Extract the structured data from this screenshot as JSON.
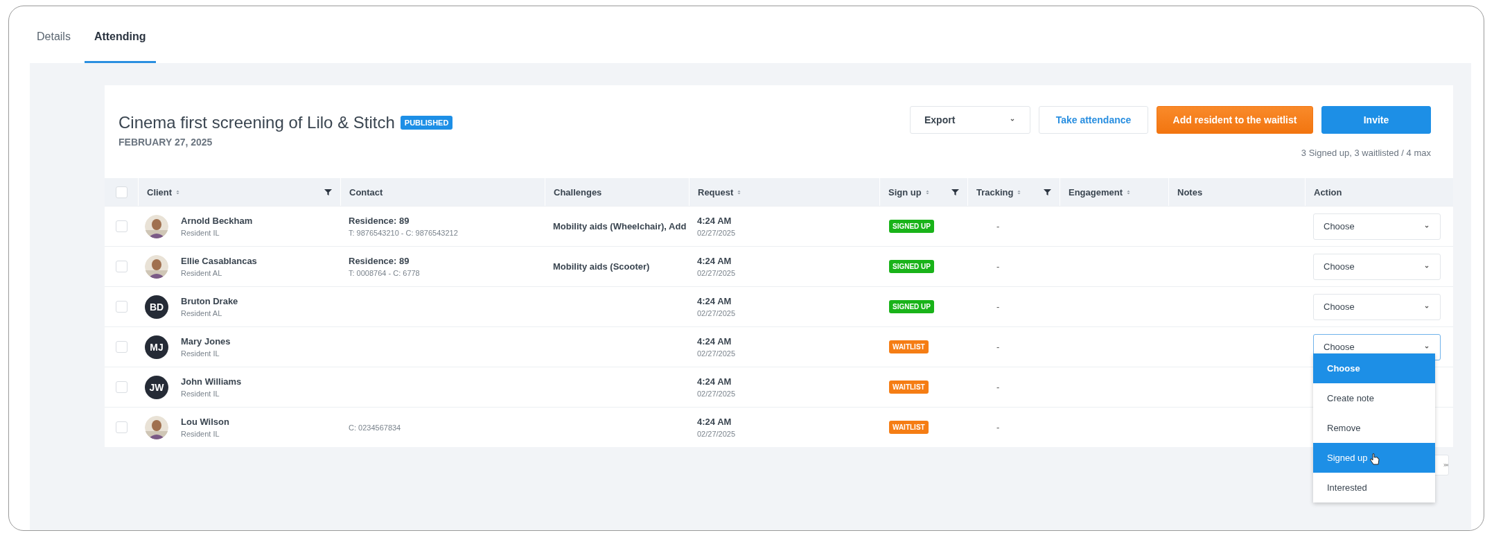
{
  "tabs": [
    {
      "label": "Details",
      "selected": false
    },
    {
      "label": "Attending",
      "selected": true
    }
  ],
  "event": {
    "title": "Cinema first screening of Lilo & Stitch",
    "status": "PUBLISHED",
    "date": "FEBRUARY 27, 2025"
  },
  "toolbar": {
    "export": "Export",
    "take_attendance": "Take attendance",
    "add_waitlist": "Add resident to the waitlist",
    "invite": "Invite",
    "summary": "3 Signed up, 3 waitlisted / 4 max"
  },
  "table": {
    "all_checked": false,
    "columns": [
      {
        "label": "Client",
        "sortable": true,
        "filter": true
      },
      {
        "label": "Contact",
        "sortable": false,
        "filter": false
      },
      {
        "label": "Challenges",
        "sortable": false,
        "filter": false
      },
      {
        "label": "Request",
        "sortable": true,
        "filter": false
      },
      {
        "label": "Sign up",
        "sortable": true,
        "filter": true
      },
      {
        "label": "Tracking",
        "sortable": true,
        "filter": true
      },
      {
        "label": "Engagement",
        "sortable": true,
        "filter": false
      },
      {
        "label": "Notes",
        "sortable": false,
        "filter": false
      },
      {
        "label": "Action",
        "sortable": false,
        "filter": false
      }
    ],
    "rows": [
      {
        "checked": false,
        "name": "Arnold Beckham",
        "level": "Resident IL",
        "contact_title": "Residence: 89",
        "contact_detail": "T: 9876543210 - C: 9876543212",
        "challenges": "Mobility aids (Wheelchair), Add",
        "time": "4:24 AM",
        "date": "02/27/2025",
        "signup": {
          "kind": "signed",
          "label": "SIGNED UP"
        },
        "tracking": "-",
        "action": "Choose",
        "open": false
      },
      {
        "checked": false,
        "name": "Ellie Casablancas",
        "level": "Resident AL",
        "contact_title": "Residence: 89",
        "contact_detail": "T: 0008764 - C: 6778",
        "challenges": "Mobility aids (Scooter)",
        "time": "4:24 AM",
        "date": "02/27/2025",
        "signup": {
          "kind": "signed",
          "label": "SIGNED UP"
        },
        "tracking": "-",
        "action": "Choose",
        "open": false
      },
      {
        "checked": false,
        "avatar": {
          "kind": "initials",
          "initials": "BD"
        },
        "name": "Bruton Drake",
        "level": "Resident AL",
        "time": "4:24 AM",
        "date": "02/27/2025",
        "signup": {
          "kind": "signed",
          "label": "SIGNED UP"
        },
        "tracking": "-",
        "action": "Choose",
        "open": false
      },
      {
        "checked": false,
        "avatar": {
          "kind": "initials",
          "initials": "MJ"
        },
        "name": "Mary Jones",
        "level": "Resident IL",
        "time": "4:24 AM",
        "date": "02/27/2025",
        "signup": {
          "kind": "waitlist",
          "label": "WAITLIST"
        },
        "tracking": "-",
        "action": "Choose",
        "open": true
      },
      {
        "checked": false,
        "avatar": {
          "kind": "initials",
          "initials": "JW"
        },
        "name": "John Williams",
        "level": "Resident IL",
        "time": "4:24 AM",
        "date": "02/27/2025",
        "signup": {
          "kind": "waitlist",
          "label": "WAITLIST"
        },
        "tracking": "-"
      },
      {
        "checked": false,
        "name": "Lou Wilson",
        "level": "Resident IL",
        "contact_detail": "C: 0234567834",
        "time": "4:24 AM",
        "date": "02/27/2025",
        "signup": {
          "kind": "waitlist",
          "label": "WAITLIST"
        },
        "tracking": "-"
      }
    ]
  },
  "dropdown": {
    "options": [
      {
        "label": "Choose",
        "selected": true,
        "hovered": false
      },
      {
        "label": "Create note",
        "selected": false,
        "hovered": false
      },
      {
        "label": "Remove",
        "selected": false,
        "hovered": false
      },
      {
        "label": "Signed up",
        "selected": false,
        "hovered": true
      },
      {
        "label": "Interested",
        "selected": false,
        "hovered": false
      }
    ]
  }
}
